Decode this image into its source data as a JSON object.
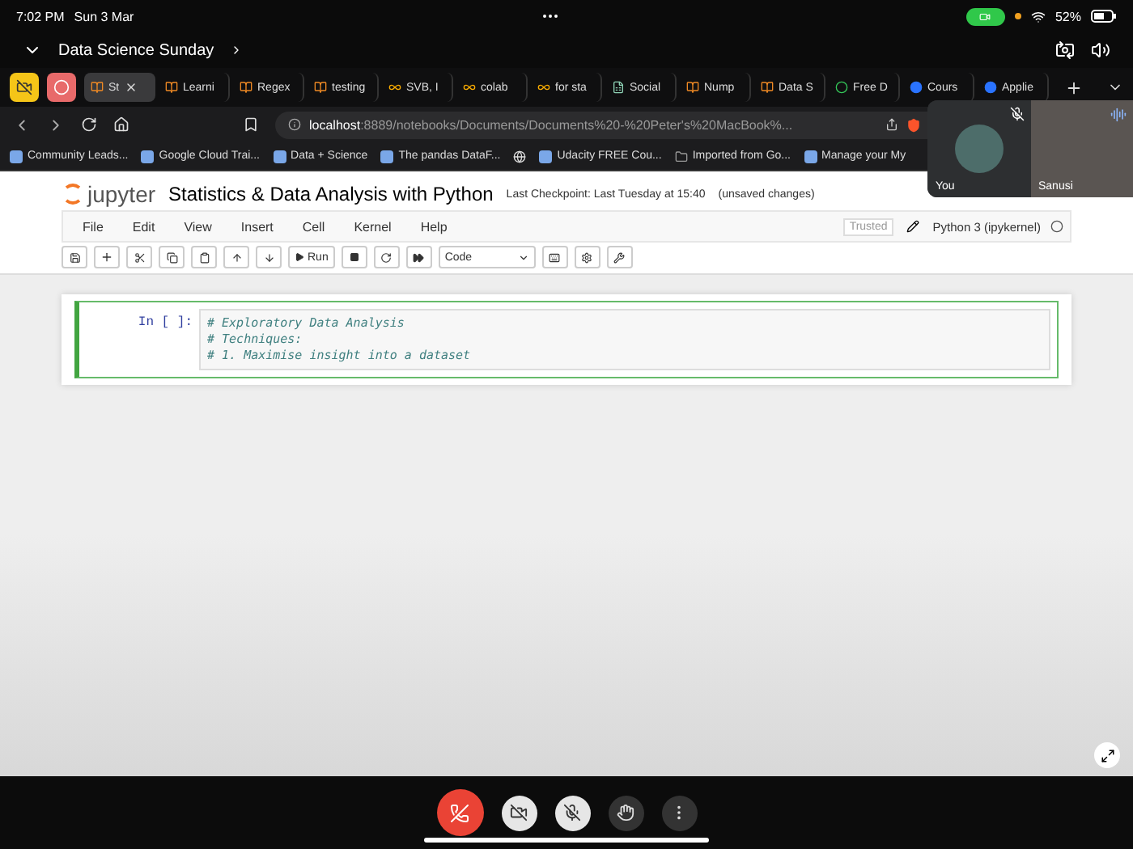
{
  "status_bar": {
    "time": "7:02 PM",
    "date": "Sun 3 Mar",
    "battery": "52%"
  },
  "meeting": {
    "title": "Data Science Sunday"
  },
  "browser": {
    "tabs": [
      {
        "label": "St",
        "selected": true,
        "kind": "doc"
      },
      {
        "label": "Learni",
        "selected": false,
        "kind": "doc"
      },
      {
        "label": "Regex",
        "selected": false,
        "kind": "doc"
      },
      {
        "label": "testing",
        "selected": false,
        "kind": "doc"
      },
      {
        "label": "SVB, I",
        "selected": false,
        "kind": "colab"
      },
      {
        "label": "colab",
        "selected": false,
        "kind": "colab"
      },
      {
        "label": "for sta",
        "selected": false,
        "kind": "colab"
      },
      {
        "label": "Social",
        "selected": false,
        "kind": "sheet"
      },
      {
        "label": "Nump",
        "selected": false,
        "kind": "doc"
      },
      {
        "label": "Data S",
        "selected": false,
        "kind": "doc"
      },
      {
        "label": "Free D",
        "selected": false,
        "kind": "ring"
      },
      {
        "label": "Cours",
        "selected": false,
        "kind": "course"
      },
      {
        "label": "Applie",
        "selected": false,
        "kind": "course"
      }
    ],
    "url_host": "localhost",
    "url_path": ":8889/notebooks/Documents/Documents%20-%20Peter's%20MacBook%...",
    "bookmarks": [
      {
        "kind": "link",
        "label": "Community Leads..."
      },
      {
        "kind": "link",
        "label": "Google Cloud Trai..."
      },
      {
        "kind": "link",
        "label": "Data + Science"
      },
      {
        "kind": "link",
        "label": "The pandas DataF..."
      },
      {
        "kind": "globe"
      },
      {
        "kind": "link",
        "label": "Udacity FREE Cou..."
      },
      {
        "kind": "folder",
        "label": "Imported from Go..."
      },
      {
        "kind": "link",
        "label": "Manage your My"
      }
    ]
  },
  "video_tiles": [
    {
      "name": "You",
      "kind": "self"
    },
    {
      "name": "Sanusi",
      "kind": "other"
    }
  ],
  "notebook": {
    "logo": "jupyter",
    "title": "Statistics & Data Analysis with Python",
    "checkpoint": "Last Checkpoint: Last Tuesday at 15:40",
    "unsaved": "(unsaved changes)",
    "menu": [
      "File",
      "Edit",
      "View",
      "Insert",
      "Cell",
      "Kernel",
      "Help"
    ],
    "trusted": "Trusted",
    "kernel": "Python 3 (ipykernel)",
    "run": "Run",
    "cell_type": "Code",
    "cells": [
      {
        "prompt": "In [ ]:",
        "selected": true,
        "lines": [
          "# Exploratory Data Analysis",
          "# Techniques:",
          "# 1. Maximise insight into a dataset"
        ]
      }
    ]
  }
}
